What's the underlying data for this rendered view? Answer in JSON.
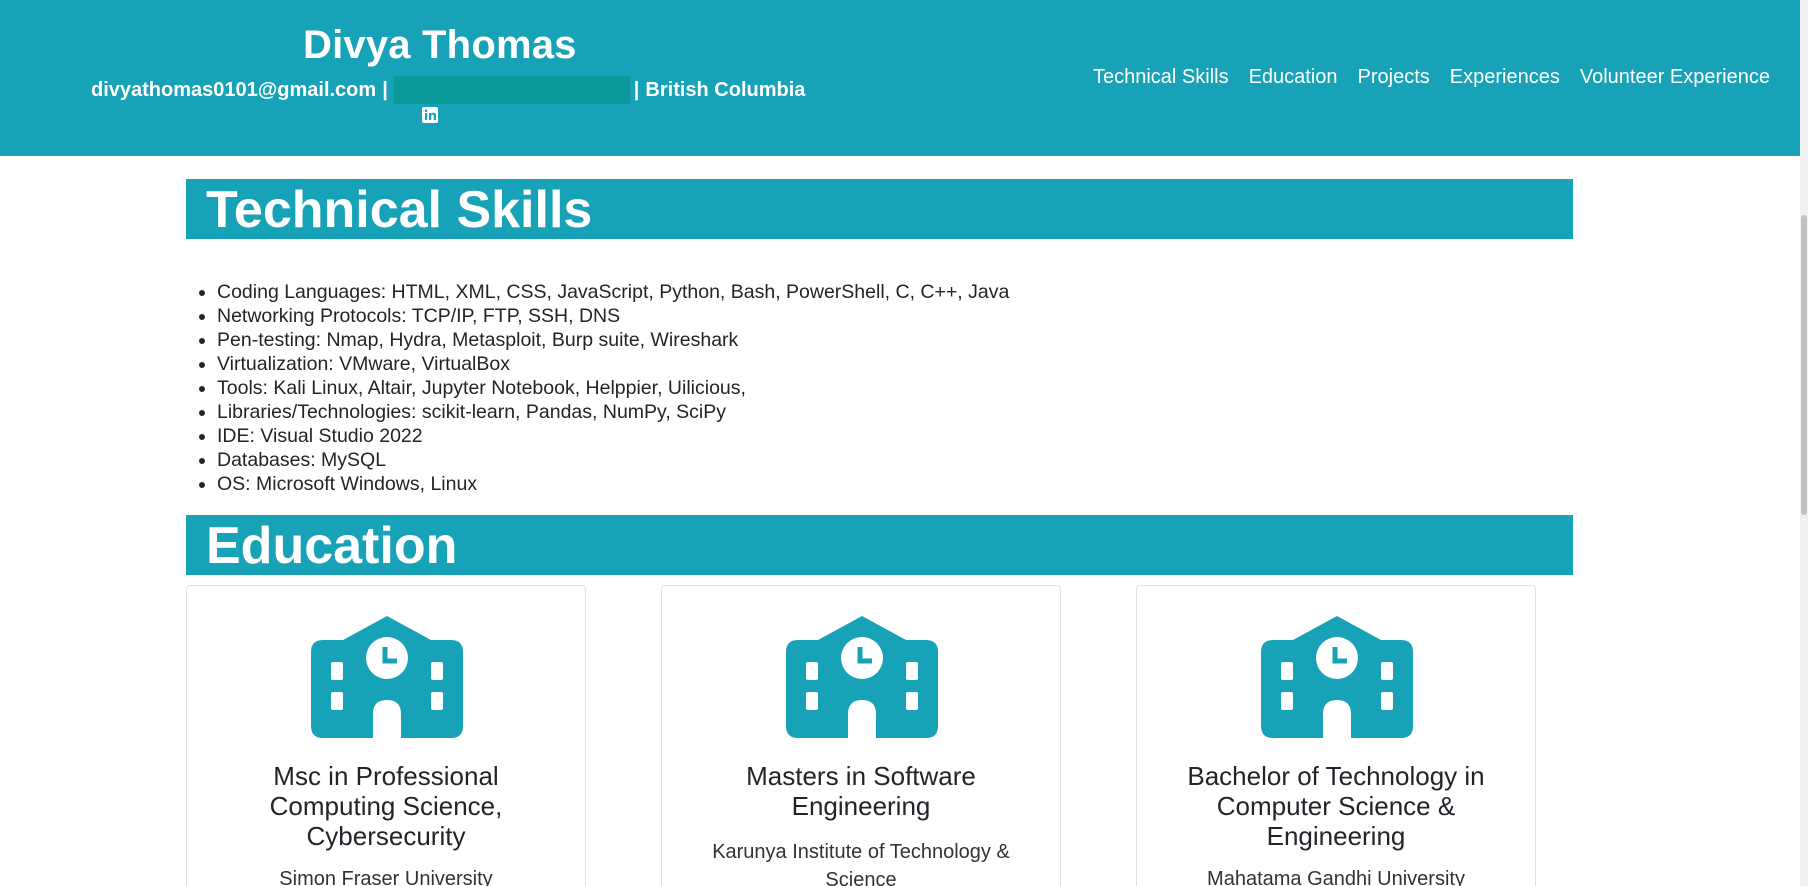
{
  "header": {
    "name": "Divya Thomas",
    "email": "divyathomas0101@gmail.com",
    "separator_1": "|",
    "separator_2": "|",
    "location": "British Columbia",
    "linkedin_icon": "linkedin-icon",
    "colors": {
      "header_bg": "#17a2b8",
      "redaction": "#0b9a98"
    }
  },
  "nav": {
    "items": [
      {
        "label": "Technical Skills"
      },
      {
        "label": "Education"
      },
      {
        "label": "Projects"
      },
      {
        "label": "Experiences"
      },
      {
        "label": "Volunteer Experience"
      }
    ]
  },
  "skills": {
    "title": "Technical Skills",
    "items": [
      "Coding Languages: HTML, XML, CSS, JavaScript, Python, Bash, PowerShell, C, C++, Java",
      "Networking Protocols: TCP/IP, FTP, SSH, DNS",
      "Pen-testing: Nmap, Hydra, Metasploit, Burp suite, Wireshark",
      "Virtualization: VMware, VirtualBox",
      "Tools: Kali Linux, Altair, Jupyter Notebook, Helppier, Uilicious,",
      "Libraries/Technologies: scikit-learn, Pandas, NumPy, SciPy",
      "IDE: Visual Studio 2022",
      "Databases: MySQL",
      "OS: Microsoft Windows, Linux"
    ]
  },
  "education": {
    "title": "Education",
    "icon": "school-icon",
    "cards": [
      {
        "degree": "Msc in Professional Computing Science, Cybersecurity",
        "institution": "Simon Fraser University"
      },
      {
        "degree": "Masters in Software Engineering",
        "institution": "Karunya Institute of Technology & Science"
      },
      {
        "degree": "Bachelor of Technology in Computer Science & Engineering",
        "institution": "Mahatama Gandhi University"
      }
    ]
  }
}
